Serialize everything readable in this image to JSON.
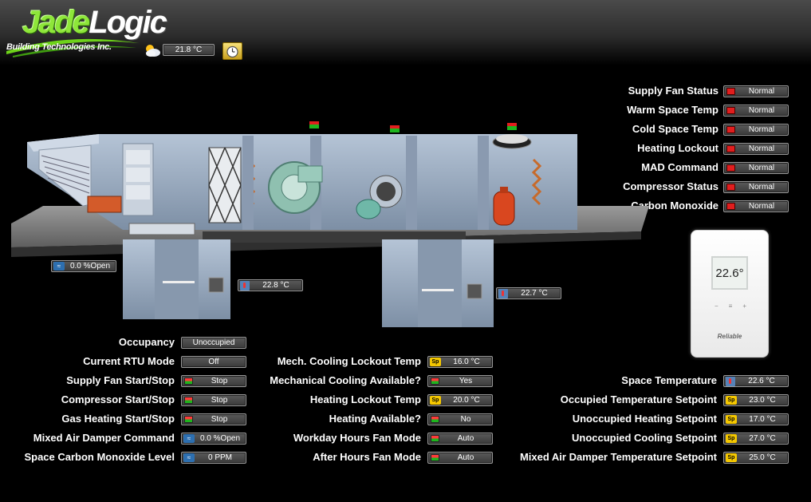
{
  "header": {
    "logo_main": "Jade",
    "logo_second": "Logic",
    "logo_sub": "Building Technologies Inc.",
    "outdoor_temp": "21.8 °C"
  },
  "status": [
    {
      "label": "Supply Fan Status",
      "value": "Normal"
    },
    {
      "label": "Warm Space Temp",
      "value": "Normal"
    },
    {
      "label": "Cold Space Temp",
      "value": "Normal"
    },
    {
      "label": "Heating Lockout",
      "value": "Normal"
    },
    {
      "label": "MAD Command",
      "value": "Normal"
    },
    {
      "label": "Compressor Status",
      "value": "Normal"
    },
    {
      "label": "Carbon Monoxide",
      "value": "Normal"
    }
  ],
  "equipment": {
    "damper_position": "0.0 %Open",
    "return_temp": "22.8 °C",
    "supply_temp": "22.7 °C"
  },
  "thermostat": {
    "display": "22.6°",
    "brand": "Reliable",
    "controls": [
      "−",
      "≡",
      "+"
    ]
  },
  "left_column": [
    {
      "label": "Occupancy",
      "value": "Unoccupied",
      "icon": "none"
    },
    {
      "label": "Current RTU Mode",
      "value": "Off",
      "icon": "none"
    },
    {
      "label": "Supply Fan Start/Stop",
      "value": "Stop",
      "icon": "indicator"
    },
    {
      "label": "Compressor Start/Stop",
      "value": "Stop",
      "icon": "indicator"
    },
    {
      "label": "Gas Heating Start/Stop",
      "value": "Stop",
      "icon": "indicator"
    },
    {
      "label": "Mixed Air Damper Command",
      "value": "0.0 %Open",
      "icon": "analog"
    },
    {
      "label": "Space Carbon Monoxide Level",
      "value": "0 PPM",
      "icon": "analog"
    }
  ],
  "middle_column": [
    {
      "label": "Mech. Cooling Lockout Temp",
      "value": "16.0 °C",
      "icon": "setpoint"
    },
    {
      "label": "Mechanical Cooling Available?",
      "value": "Yes",
      "icon": "indicator"
    },
    {
      "label": "Heating Lockout Temp",
      "value": "20.0 °C",
      "icon": "setpoint"
    },
    {
      "label": "Heating Available?",
      "value": "No",
      "icon": "indicator"
    },
    {
      "label": "Workday Hours Fan Mode",
      "value": "Auto",
      "icon": "indicator"
    },
    {
      "label": "After Hours Fan Mode",
      "value": "Auto",
      "icon": "indicator"
    }
  ],
  "right_column": [
    {
      "label": "Space Temperature",
      "value": "22.6 °C",
      "icon": "temperature"
    },
    {
      "label": "Occupied Temperature Setpoint",
      "value": "23.0 °C",
      "icon": "setpoint"
    },
    {
      "label": "Unoccupied Heating Setpoint",
      "value": "17.0 °C",
      "icon": "setpoint"
    },
    {
      "label": "Unoccupied Cooling Setpoint",
      "value": "27.0 °C",
      "icon": "setpoint"
    },
    {
      "label": "Mixed Air Damper Temperature Setpoint",
      "value": "25.0 °C",
      "icon": "setpoint"
    }
  ],
  "icon_text": {
    "setpoint": "Sp",
    "analog": "≈"
  },
  "colors": {
    "logo_green": "#8ee63a",
    "status_red": "#e01e1e",
    "status_green": "#1eb51e",
    "setpoint_yellow": "#f5c800"
  }
}
